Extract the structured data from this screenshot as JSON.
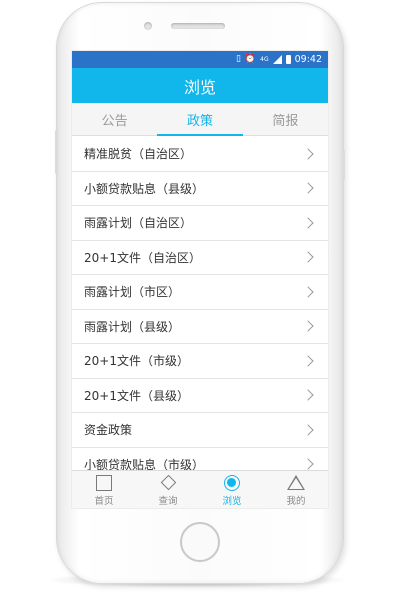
{
  "status_bar": {
    "icons": [
      "vibrate-icon",
      "alarm-icon",
      "4g-signal-icon",
      "battery-icon"
    ],
    "network": "4G",
    "time": "09:42"
  },
  "header": {
    "title": "浏览"
  },
  "tabs": [
    {
      "label": "公告",
      "active": false
    },
    {
      "label": "政策",
      "active": true
    },
    {
      "label": "简报",
      "active": false
    }
  ],
  "policy_list": [
    {
      "label": "精准脱贫（自治区）"
    },
    {
      "label": "小额贷款贴息（县级）"
    },
    {
      "label": "雨露计划（自治区）"
    },
    {
      "label": "20+1文件（自治区）"
    },
    {
      "label": "雨露计划（市区）"
    },
    {
      "label": "雨露计划（县级）"
    },
    {
      "label": "20+1文件（市级）"
    },
    {
      "label": "20+1文件（县级）"
    },
    {
      "label": "资金政策"
    },
    {
      "label": "小额贷款贴息（市级）"
    }
  ],
  "bottom_nav": [
    {
      "label": "首页",
      "icon": "home-square-icon",
      "active": false
    },
    {
      "label": "查询",
      "icon": "query-diamond-icon",
      "active": false
    },
    {
      "label": "浏览",
      "icon": "browse-circle-icon",
      "active": true
    },
    {
      "label": "我的",
      "icon": "profile-triangle-icon",
      "active": false
    }
  ],
  "colors": {
    "status_bar": "#2b72c9",
    "accent": "#11b6ea",
    "inactive_text": "#9a9a9a"
  }
}
